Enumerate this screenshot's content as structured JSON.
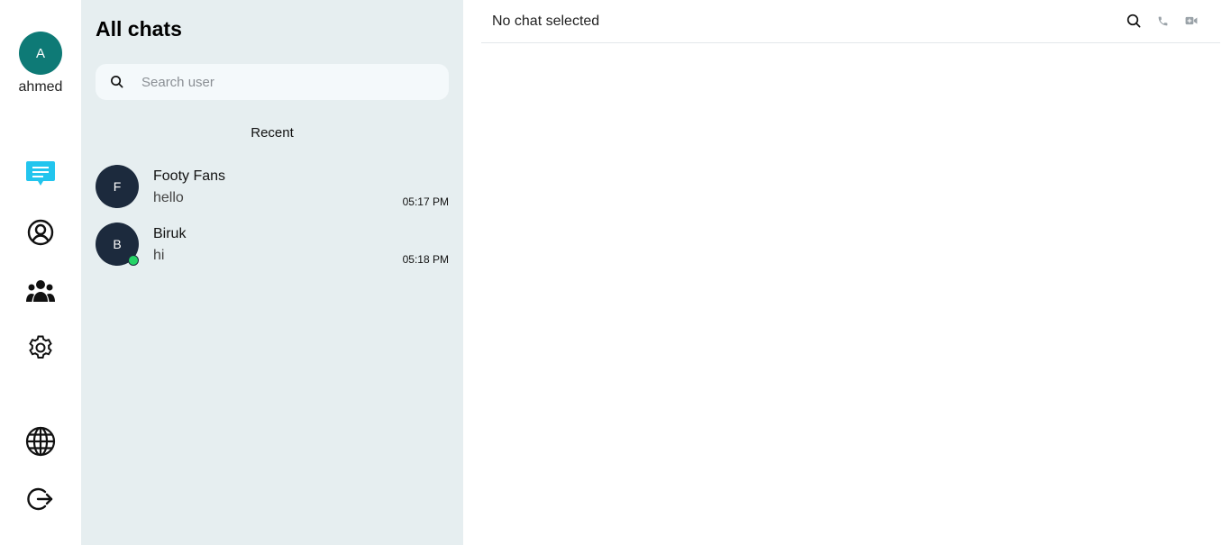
{
  "user": {
    "initial": "A",
    "name": "ahmed",
    "avatar_color": "#0e7a76"
  },
  "rail": {
    "icons": [
      "chat-icon",
      "user-circle-icon",
      "group-icon",
      "gear-icon",
      "globe-icon",
      "logout-icon"
    ],
    "active": "chat-icon",
    "active_color": "#22c5ee"
  },
  "panel": {
    "title": "All chats",
    "search": {
      "placeholder": "Search user",
      "value": ""
    },
    "recent_label": "Recent",
    "chats": [
      {
        "initial": "F",
        "name": "Footy Fans",
        "last_message": "hello",
        "time": "05:17 PM",
        "online": false
      },
      {
        "initial": "B",
        "name": "Biruk",
        "last_message": "hi",
        "time": "05:18 PM",
        "online": true
      }
    ],
    "background": "#e6eef0"
  },
  "main": {
    "header_text": "No chat selected",
    "header_icons": [
      "search-icon",
      "phone-icon",
      "video-icon"
    ]
  }
}
